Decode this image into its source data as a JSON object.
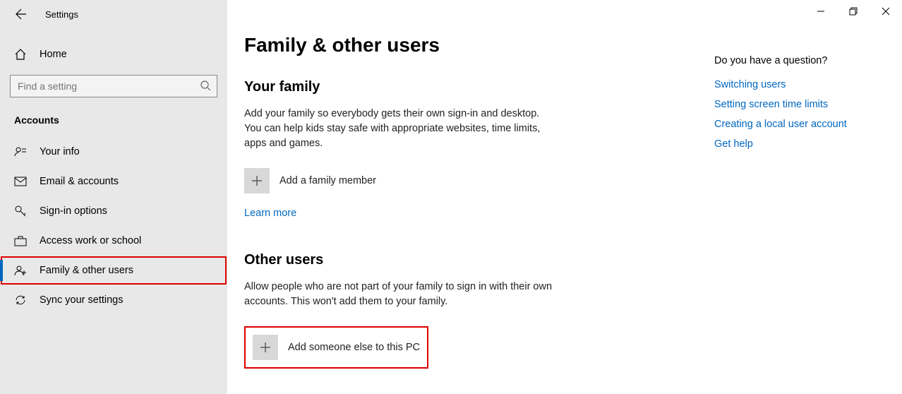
{
  "app_title": "Settings",
  "sidebar": {
    "home": "Home",
    "search_placeholder": "Find a setting",
    "category": "Accounts",
    "items": [
      {
        "label": "Your info"
      },
      {
        "label": "Email & accounts"
      },
      {
        "label": "Sign-in options"
      },
      {
        "label": "Access work or school"
      },
      {
        "label": "Family & other users"
      },
      {
        "label": "Sync your settings"
      }
    ]
  },
  "page": {
    "title": "Family & other users",
    "family": {
      "heading": "Your family",
      "desc": "Add your family so everybody gets their own sign-in and desktop. You can help kids stay safe with appropriate websites, time limits, apps and games.",
      "add_label": "Add a family member",
      "learn_more": "Learn more"
    },
    "other": {
      "heading": "Other users",
      "desc": "Allow people who are not part of your family to sign in with their own accounts. This won't add them to your family.",
      "add_label": "Add someone else to this PC"
    }
  },
  "help": {
    "title": "Do you have a question?",
    "links": [
      "Switching users",
      "Setting screen time limits",
      "Creating a local user account",
      "Get help"
    ]
  }
}
